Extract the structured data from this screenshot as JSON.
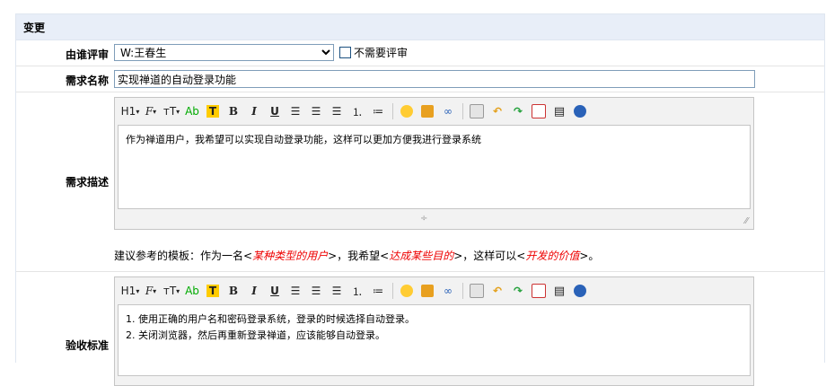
{
  "section": {
    "title": "变更"
  },
  "reviewer": {
    "label": "由谁评审",
    "selected": "W:王春生",
    "no_review_label": "不需要评审"
  },
  "story_name": {
    "label": "需求名称",
    "value": "实现禅道的自动登录功能",
    "required_mark": "*"
  },
  "description": {
    "label": "需求描述",
    "content": "作为禅道用户，我希望可以实现自动登录功能，这样可以更加方便我进行登录系统",
    "hint": {
      "prefix": "建议参考的模板：作为一名<",
      "role": "某种类型的用户",
      "mid1": ">，我希望<",
      "goal": "达成某些目的",
      "mid2": ">，这样可以<",
      "value": "开发的价值",
      "suffix": ">。"
    }
  },
  "acceptance": {
    "label": "验收标准",
    "lines": [
      "1. 使用正确的用户名和密码登录系统，登录的时候选择自动登录。",
      "2. 关闭浏览器，然后再重新登录禅道，应该能够自动登录。"
    ]
  },
  "toolbar": {
    "heading": "H1",
    "font": "F",
    "font_size": "тT",
    "font_color": "Ab",
    "highlight": "T",
    "bold": "B",
    "italic": "I",
    "underline": "U",
    "arrow": "▾"
  },
  "colors": {
    "header_bg": "#e8eef8",
    "required": "#e00000",
    "highlight": "#ffcc00"
  }
}
